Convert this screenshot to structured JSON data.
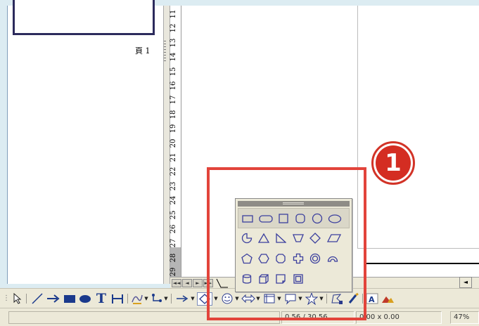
{
  "slide_panel": {
    "page_label": "頁 1"
  },
  "ruler": {
    "numbers": [
      "11",
      "12",
      "13",
      "14",
      "15",
      "16",
      "17",
      "18",
      "19",
      "20",
      "21",
      "22",
      "23",
      "24",
      "25",
      "26",
      "27",
      "28",
      "29"
    ]
  },
  "nav": {
    "buttons": [
      "◄◄",
      "◄",
      "►",
      "►►"
    ]
  },
  "callout": {
    "number": "1"
  },
  "status": {
    "position": "0.56 / 30.56",
    "size": "0.00 x 0.00",
    "zoom": "47%"
  },
  "drawbar": {
    "text_tool": "T"
  },
  "colors": {
    "highlight": "#e2443b",
    "shape_stroke": "#3b3f9e",
    "background": "#dcecf2"
  }
}
